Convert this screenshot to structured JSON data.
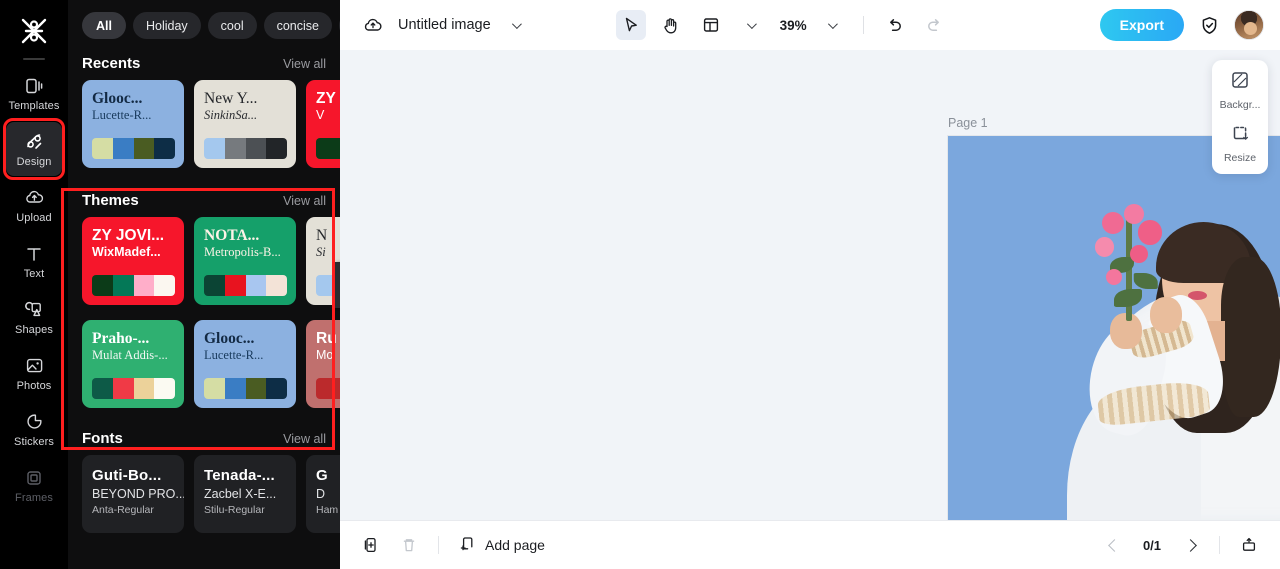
{
  "rail": {
    "logo_icon": "capcut-logo-icon",
    "items": [
      {
        "label": "Templates",
        "icon": "templates-icon",
        "state": "normal"
      },
      {
        "label": "Design",
        "icon": "design-icon",
        "state": "active"
      },
      {
        "label": "Upload",
        "icon": "upload-cloud-icon",
        "state": "normal"
      },
      {
        "label": "Text",
        "icon": "text-icon",
        "state": "normal"
      },
      {
        "label": "Shapes",
        "icon": "shapes-icon",
        "state": "normal"
      },
      {
        "label": "Photos",
        "icon": "photos-icon",
        "state": "normal"
      },
      {
        "label": "Stickers",
        "icon": "stickers-icon",
        "state": "normal"
      },
      {
        "label": "Frames",
        "icon": "frames-icon",
        "state": "dim"
      }
    ]
  },
  "panel": {
    "filters": [
      {
        "label": "All",
        "selected": true
      },
      {
        "label": "Holiday",
        "selected": false
      },
      {
        "label": "cool",
        "selected": false
      },
      {
        "label": "concise",
        "selected": false
      }
    ],
    "filter_expand_icon": "chevron-down-icon",
    "sections": {
      "recents": {
        "title": "Recents",
        "view_all": "View all",
        "cards": [
          {
            "title": "Glooc...",
            "subtitle": "Lucette-R...",
            "bg": "#8cb1e0",
            "title_color": "#132a44",
            "sub_color": "#183a5c",
            "swatches": [
              "#d5dda4",
              "#3a7dc4",
              "#4a5c22",
              "#0d2d46"
            ]
          },
          {
            "title": "New Y...",
            "subtitle": "SinkinSa...",
            "bg": "#e3e0d7",
            "title_color": "#24262a",
            "sub_color": "#2a2c30",
            "swatches": [
              "#a4c8ee",
              "#767a7e",
              "#4c5054",
              "#222528"
            ]
          },
          {
            "title": "ZY",
            "subtitle": "V",
            "bg": "#f6162b",
            "title_color": "#ffffff",
            "sub_color": "#ffffff",
            "swatches": [
              "#0c3b18",
              "#0c3b18",
              "#0c3b18",
              "#0c3b18"
            ]
          }
        ]
      },
      "themes": {
        "title": "Themes",
        "view_all": "View all",
        "cards": [
          {
            "title": "ZY JOVI...",
            "subtitle": "WixMadef...",
            "bg": "#f6162b",
            "title_color": "#ffffff",
            "sub_color": "#ffffff",
            "swatches": [
              "#0c3b18",
              "#047857",
              "#ffaec9",
              "#fbf7f0"
            ]
          },
          {
            "title": "NOTA...",
            "subtitle": "Metropolis-B...",
            "bg": "#15a06a",
            "title_color": "#fdf3e7",
            "sub_color": "#fdf3e7",
            "swatches": [
              "#0b4434",
              "#e8131f",
              "#a8c6f0",
              "#f3e3d7"
            ]
          },
          {
            "title": "N",
            "subtitle": "Si",
            "bg": "#e3e0d7",
            "title_color": "#24262a",
            "sub_color": "#2a2c30",
            "swatches": [
              "#a4c8ee",
              "#a4c8ee",
              "#a4c8ee",
              "#a4c8ee"
            ]
          },
          {
            "title": "Praho-...",
            "subtitle": "Mulat Addis-...",
            "bg": "#2fb071",
            "title_color": "#ffffff",
            "sub_color": "#f2f7f3",
            "swatches": [
              "#0d5a47",
              "#f03a46",
              "#ecd29a",
              "#fbfaf2"
            ]
          },
          {
            "title": "Glooc...",
            "subtitle": "Lucette-R...",
            "bg": "#8cb1e0",
            "title_color": "#132a44",
            "sub_color": "#183a5c",
            "swatches": [
              "#d5dda4",
              "#3a7dc4",
              "#4a5c22",
              "#0d2d46"
            ]
          },
          {
            "title": "Ru",
            "subtitle": "Mo",
            "bg": "#c0706e",
            "title_color": "#ffffff",
            "sub_color": "#ffffff",
            "swatches": [
              "#bb2a2c",
              "#bb2a2c",
              "#bb2a2c",
              "#bb2a2c"
            ]
          }
        ],
        "next_icon": "chevron-right-icon"
      },
      "fonts": {
        "title": "Fonts",
        "view_all": "View all",
        "cards": [
          {
            "line1": "Guti-Bo...",
            "line2": "BEYOND PRO...",
            "line3": "Anta-Regular"
          },
          {
            "line1": "Tenada-...",
            "line2": "Zacbel X-E...",
            "line3": "Stilu-Regular"
          },
          {
            "line1": "G",
            "line2": "D",
            "line3": "Ham"
          }
        ],
        "next_icon": "chevron-right-icon"
      }
    }
  },
  "topbar": {
    "cloud_icon": "cloud-save-icon",
    "doc_name": "Untitled image",
    "doc_menu_icon": "chevron-down-icon",
    "tools": [
      {
        "name": "select-tool",
        "icon": "cursor-arrow-icon",
        "selected": true
      },
      {
        "name": "hand-tool",
        "icon": "hand-icon",
        "selected": false
      },
      {
        "name": "layout-tool",
        "icon": "layout-grid-icon",
        "selected": false
      }
    ],
    "zoom_level": "39%",
    "zoom_menu_icon": "chevron-down-icon",
    "undo_icon": "undo-icon",
    "redo_icon": "redo-icon",
    "export_label": "Export",
    "shield_icon": "shield-check-icon",
    "avatar_name": "user-avatar"
  },
  "canvas": {
    "page_label": "Page 1",
    "artwork_alt": "woman in white dress holding pink flowers on blue background",
    "background_color": "#7ba7dd"
  },
  "float_panel": {
    "items": [
      {
        "label": "Backgr...",
        "icon": "background-pattern-icon"
      },
      {
        "label": "Resize",
        "icon": "resize-icon"
      }
    ]
  },
  "bottombar": {
    "duplicate_icon": "duplicate-page-icon",
    "delete_icon": "trash-icon",
    "add_page_label": "Add page",
    "add_page_icon": "add-page-icon",
    "prev_icon": "chevron-left-icon",
    "page_indicator": "0/1",
    "next_icon": "chevron-right-icon",
    "grid_view_icon": "page-grid-icon"
  },
  "annotations": {
    "color": "#ff1f1f",
    "boxes": [
      "design-rail-item",
      "themes-section"
    ]
  }
}
